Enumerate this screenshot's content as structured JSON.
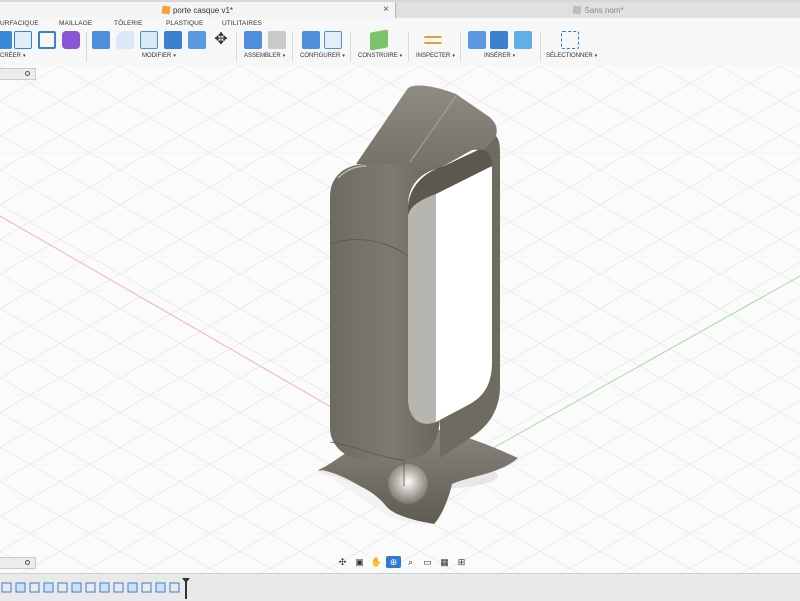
{
  "tabs": {
    "active_title": "porte casque v1*",
    "inactive_title": "Sans nom*",
    "close_glyph": "×"
  },
  "workspace_tabs": [
    "URFACIQUE",
    "MAILLAGE",
    "TÔLERIE",
    "PLASTIQUE",
    "UTILITAIRES"
  ],
  "tool_groups": [
    "CRÉER",
    "MODIFIER",
    "ASSEMBLER",
    "CONFIGURER",
    "CONSTRUIRE",
    "INSPECTER",
    "INSÉRER",
    "SÉLECTIONNER"
  ],
  "caret_glyph": "▾",
  "colors": {
    "accent_blue": "#2f7bd2",
    "model_body": "#78746a",
    "model_base": "#7e7a70",
    "grid_line": "#e3e3e3",
    "axis_red": "#f2a9a9",
    "axis_green": "#9fdc9a",
    "doc_icon": "#f5a23a"
  },
  "icons": {
    "viewport_navigation": [
      "orbit-icon",
      "look-at-icon",
      "pan-icon",
      "zoom-icon",
      "zoom-window-icon",
      "display-settings-icon",
      "grid-settings-icon",
      "viewports-icon"
    ],
    "timeline": [
      "go-to-start-icon",
      "previous-step-icon",
      "play-icon",
      "next-step-icon",
      "go-to-end-icon"
    ]
  }
}
